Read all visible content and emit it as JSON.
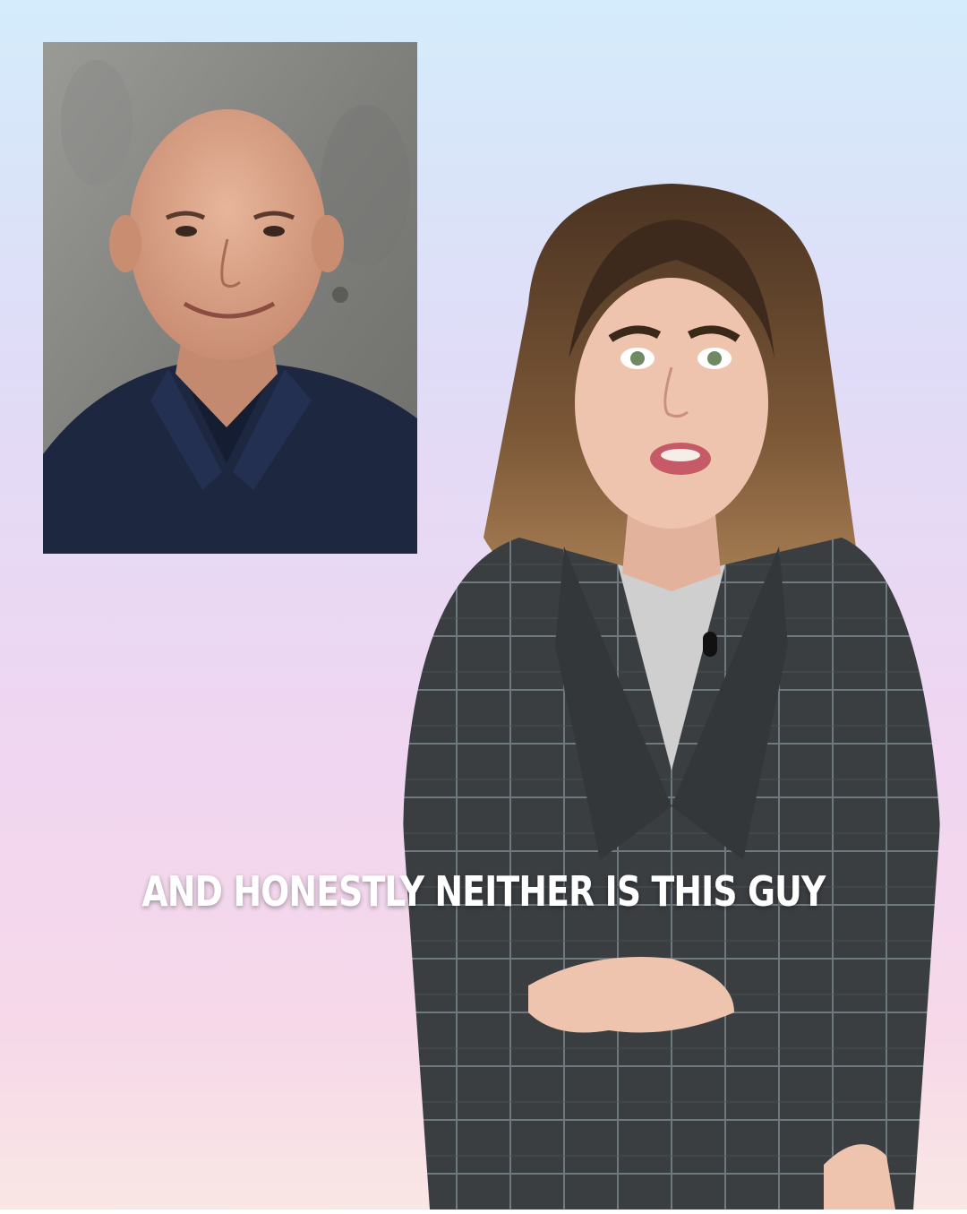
{
  "caption": {
    "text": "AND HONESTLY NEITHER IS THIS GUY"
  },
  "colors": {
    "background_top": "#d4ecfb",
    "background_bottom": "#f9e7e4",
    "caption_text": "#ffffff",
    "inset_shirt": "#1d2740",
    "presenter_blazer": "#3a3e41"
  },
  "icons": {
    "inset_photo": "man-portrait",
    "presenter": "woman-presenter"
  }
}
